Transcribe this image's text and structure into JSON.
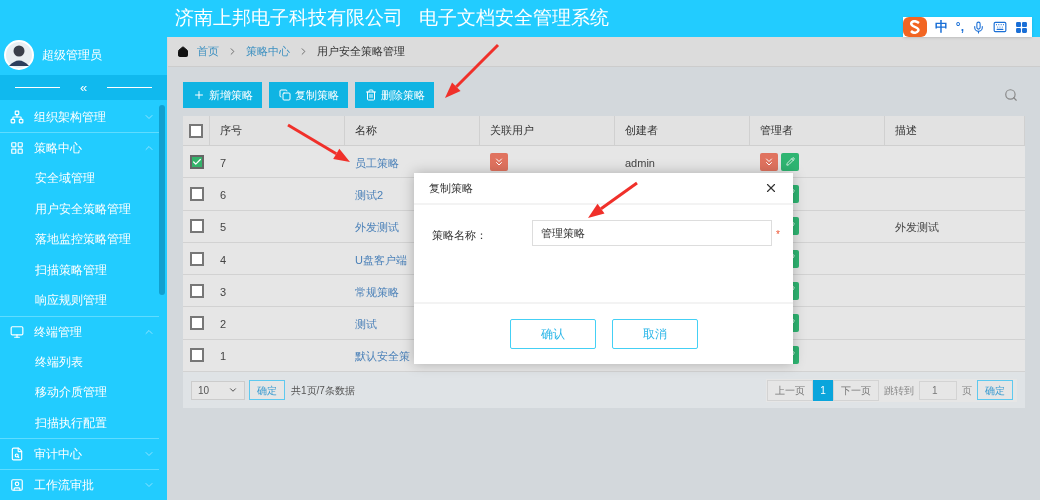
{
  "header": {
    "title": "济南上邦电子科技有限公司   电子文档安全管理系统"
  },
  "ime_toolbar": {
    "mode": "中",
    "punct": "°,"
  },
  "user": {
    "name": "超级管理员"
  },
  "collapse": {
    "label": "«"
  },
  "sidebar": {
    "groups": [
      {
        "label": "组织架构管理",
        "expanded": false
      },
      {
        "label": "策略中心",
        "expanded": true,
        "children": [
          {
            "label": "安全域管理",
            "selected": false
          },
          {
            "label": "用户安全策略管理",
            "selected": false
          },
          {
            "label": "落地监控策略管理",
            "selected": false
          },
          {
            "label": "扫描策略管理",
            "selected": false
          },
          {
            "label": "响应规则管理",
            "selected": false
          }
        ]
      },
      {
        "label": "终端管理",
        "expanded": true,
        "children": [
          {
            "label": "终端列表",
            "selected": false
          },
          {
            "label": "移动介质管理",
            "selected": false
          },
          {
            "label": "扫描执行配置",
            "selected": false
          }
        ]
      },
      {
        "label": "审计中心",
        "expanded": false
      },
      {
        "label": "工作流审批",
        "expanded": false
      }
    ]
  },
  "breadcrumb": [
    {
      "label": "首页",
      "link": true
    },
    {
      "label": "策略中心",
      "link": true
    },
    {
      "label": "用户安全策略管理",
      "link": false
    }
  ],
  "toolbar": [
    {
      "label": "新增策略"
    },
    {
      "label": "复制策略"
    },
    {
      "label": "删除策略"
    }
  ],
  "table": {
    "columns": [
      "序号",
      "名称",
      "关联用户",
      "创建者",
      "管理者",
      "描述"
    ],
    "all_checked": false,
    "rows": [
      {
        "checked": true,
        "seq": "7",
        "name": "员工策略",
        "creator": "admin",
        "description": ""
      },
      {
        "checked": false,
        "seq": "6",
        "name": "测试2",
        "creator": "",
        "description": ""
      },
      {
        "checked": false,
        "seq": "5",
        "name": "外发测试",
        "creator": "",
        "description": "外发测试"
      },
      {
        "checked": false,
        "seq": "4",
        "name": "U盘客户端",
        "creator": "",
        "description": ""
      },
      {
        "checked": false,
        "seq": "3",
        "name": "常规策略",
        "creator": "",
        "description": ""
      },
      {
        "checked": false,
        "seq": "2",
        "name": "测试",
        "creator": "",
        "description": ""
      },
      {
        "checked": false,
        "seq": "1",
        "name": "默认安全策",
        "creator": "",
        "description": ""
      }
    ]
  },
  "pagination": {
    "page_size": "10",
    "apply": "确定",
    "summary": "共1页/7条数据",
    "prev": "上一页",
    "pages": [
      {
        "label": "1",
        "selected": true
      }
    ],
    "next": "下一页",
    "goto_label": "跳转到",
    "goto_value": "1",
    "page_unit": "页",
    "goto_button": "确定"
  },
  "dialog": {
    "title": "复制策略",
    "field_label": "策略名称：",
    "field_value": "管理策略",
    "required_mark": "*",
    "confirm": "确认",
    "cancel": "取消"
  }
}
